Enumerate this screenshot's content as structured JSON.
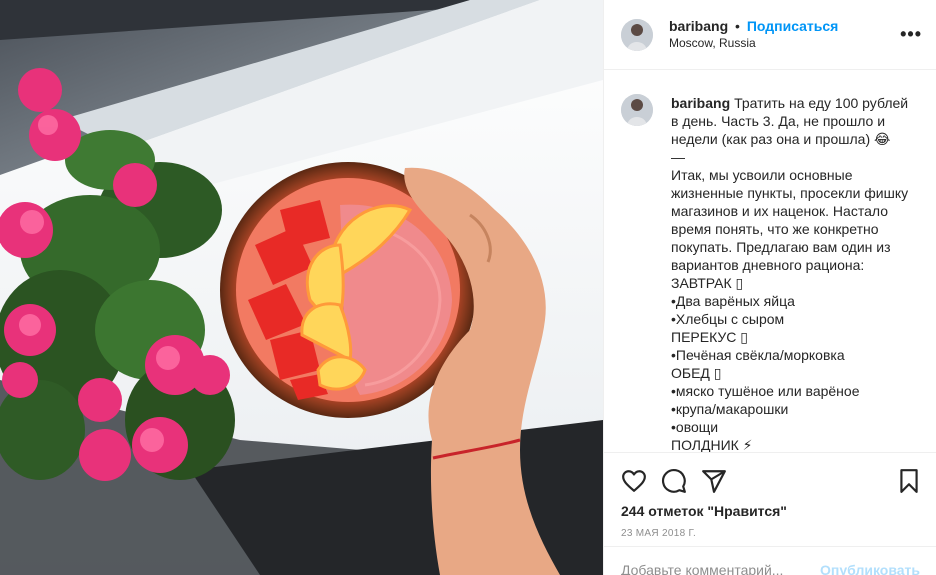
{
  "post": {
    "image_alt": "Smoothie bowl with strawberries and peach slices held by a hand near pink flowers on a windowsill",
    "colors": {
      "accent": "#0095f6",
      "border": "#efefef",
      "muted": "#8e8e8e"
    }
  },
  "header": {
    "username": "baribang",
    "separator": "•",
    "follow_label": "Подписаться",
    "location": "Moscow, Russia",
    "more_icon": "more-dots-icon",
    "more_label": "•••"
  },
  "caption": {
    "username": "baribang",
    "text": "Тратить на еду 100 рублей в день. Часть 3. Да, не прошло и недели (как раз она и прошла) 😂\n—\nИтак, мы усвоили основные жизненные пункты, просекли фишку магазинов и их наценок. Настало время понять, что же конкретно покупать. Предлагаю вам один из вариантов дневного рациона:\nЗАВТРАК ▯\n•Два варёных яйца\n•Хлебцы с сыром\nПЕРЕКУС ▯\n•Печёная свёкла/морковка\nОБЕД ▯\n•мяско тушёное или варёное\n•крупа/макарошки\n•овощи\nПОЛДНИК ⚡"
  },
  "actions": {
    "like_icon": "heart-icon",
    "comment_icon": "comment-icon",
    "share_icon": "share-icon",
    "save_icon": "bookmark-icon",
    "likes_text": "244 отметок \"Нравится\"",
    "date": "23 мая 2018 г."
  },
  "comment_form": {
    "placeholder": "Добавьте комментарий...",
    "value": "",
    "publish_label": "Опубликовать"
  }
}
